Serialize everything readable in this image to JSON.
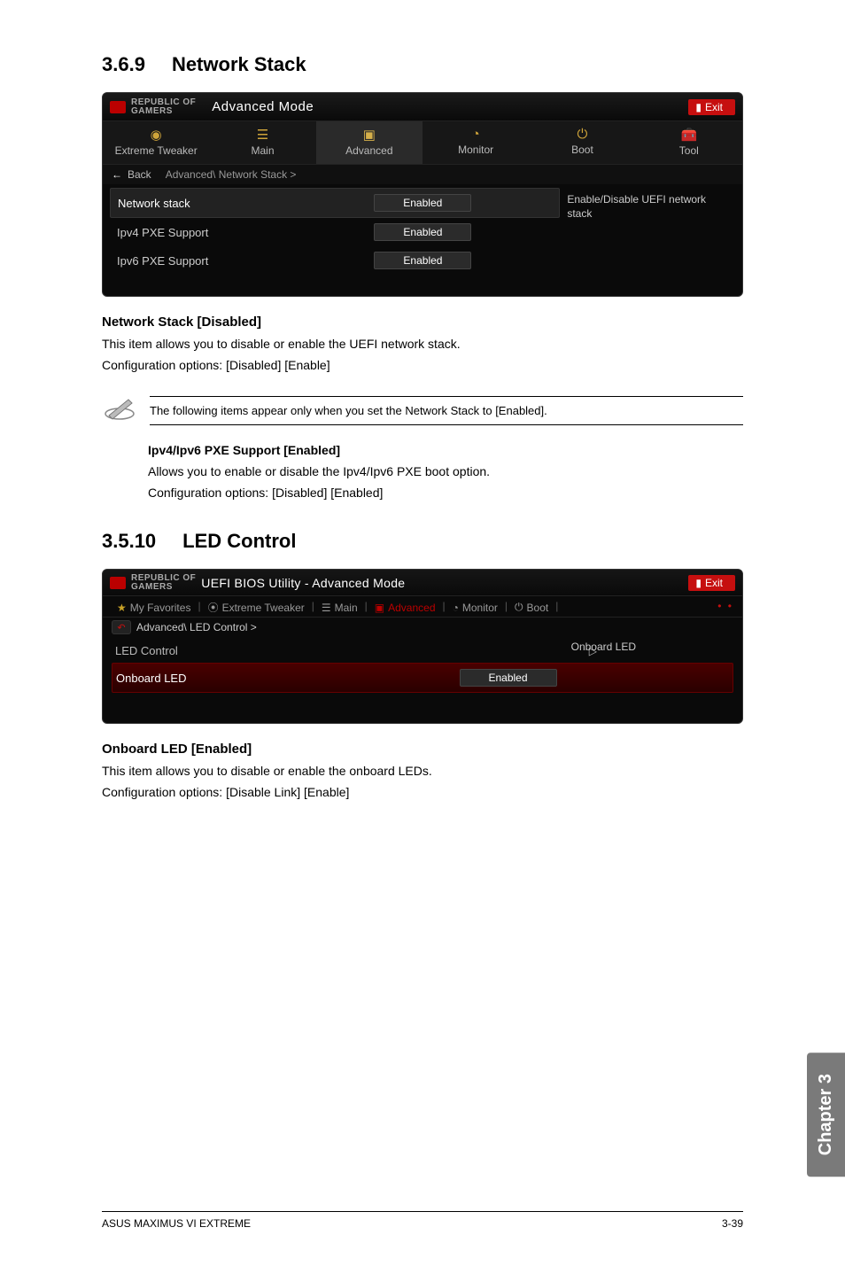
{
  "section1": {
    "num": "3.6.9",
    "title": "Network Stack"
  },
  "bios1": {
    "brand_top": "REPUBLIC OF",
    "brand_bottom": "GAMERS",
    "mode": "Advanced Mode",
    "exit": "Exit",
    "tabs": [
      "Extreme Tweaker",
      "Main",
      "Advanced",
      "Monitor",
      "Boot",
      "Tool"
    ],
    "breadcrumb_back": "Back",
    "breadcrumb": "Advanced\\ Network Stack >",
    "rows": [
      {
        "label": "Network stack",
        "value": "Enabled"
      },
      {
        "label": "Ipv4 PXE Support",
        "value": "Enabled"
      },
      {
        "label": "Ipv6 PXE Support",
        "value": "Enabled"
      }
    ],
    "hint": "Enable/Disable UEFI network stack"
  },
  "text1": {
    "heading": "Network Stack [Disabled]",
    "p1": "This item allows you to disable or enable the UEFI network stack.",
    "p2": "Configuration options: [Disabled] [Enable]"
  },
  "note": "The following items appear only when you set the Network Stack to [Enabled].",
  "pxe": {
    "heading": "Ipv4/Ipv6 PXE Support [Enabled]",
    "p1": "Allows you to enable or disable the Ipv4/Ipv6 PXE boot option.",
    "p2": "Configuration options: [Disabled] [Enabled]"
  },
  "section2": {
    "num": "3.5.10",
    "title": "LED Control"
  },
  "bios2": {
    "util": "UEFI BIOS Utility - Advanced Mode",
    "exit": "Exit",
    "tabs": [
      "My Favorites",
      "Extreme Tweaker",
      "Main",
      "Advanced",
      "Monitor",
      "Boot"
    ],
    "breadcrumb": "Advanced\\ LED Control >",
    "row_led_control": "LED Control",
    "side_hint": "Onboard LED",
    "row_onboard": "Onboard LED",
    "value_onboard": "Enabled"
  },
  "text2": {
    "heading": "Onboard LED [Enabled]",
    "p1": "This item allows you to disable or enable the onboard LEDs.",
    "p2": "Configuration options: [Disable Link] [Enable]"
  },
  "chapter": "Chapter 3",
  "footer": {
    "left": "ASUS MAXIMUS VI EXTREME",
    "right": "3-39"
  }
}
